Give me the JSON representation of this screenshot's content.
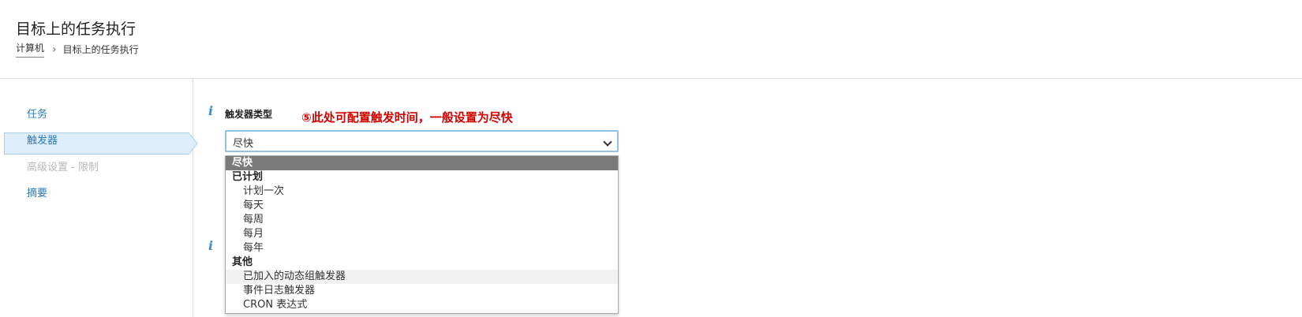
{
  "header": {
    "title": "目标上的任务执行",
    "breadcrumb": [
      "计算机",
      "目标上的任务执行"
    ]
  },
  "nav": {
    "items": [
      {
        "label": "任务",
        "state": "normal"
      },
      {
        "label": "触发器",
        "state": "active"
      },
      {
        "label": "高级设置 - 限制",
        "state": "disabled"
      },
      {
        "label": "摘要",
        "state": "normal"
      }
    ]
  },
  "form": {
    "trigger_type_label": "触发器类型",
    "annotation": "⑤此处可配置触发时间，一般设置为尽快",
    "selected_value": "尽快",
    "options": {
      "asap": "尽快",
      "scheduled_group": "已计划",
      "once": "计划一次",
      "daily": "每天",
      "weekly": "每周",
      "monthly": "每月",
      "yearly": "每年",
      "other_group": "其他",
      "dynamic_group": "已加入的动态组触发器",
      "event_log": "事件日志触发器",
      "cron": "CRON 表达式"
    }
  },
  "colors": {
    "accent": "#2a7ab8",
    "annotation": "#d40000",
    "selected_option": "#7a7a7a",
    "active_nav_bg": "#ddeefa"
  },
  "icons": {
    "info": "i",
    "breadcrumb_separator": "›"
  }
}
